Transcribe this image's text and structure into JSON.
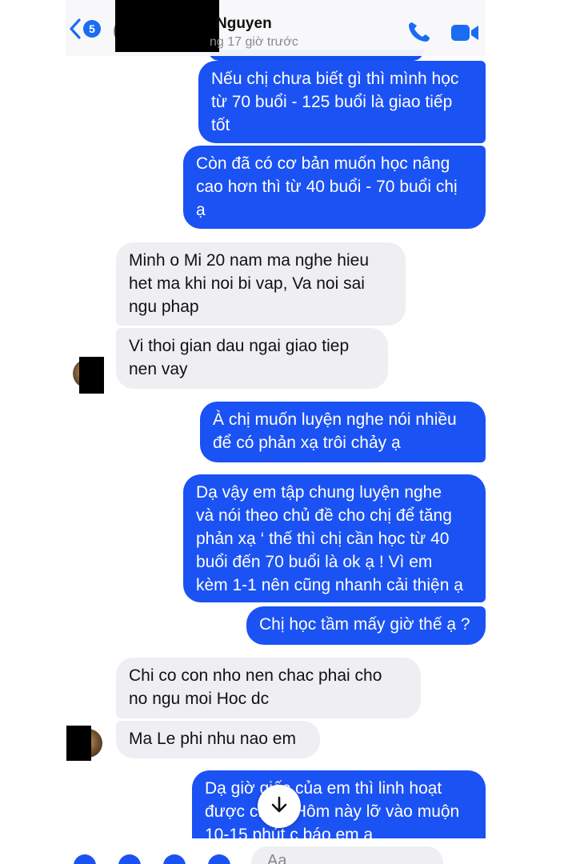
{
  "header": {
    "back_badge": "5",
    "contact_name": "Nguyen",
    "contact_status": "ng 17 giờ trước"
  },
  "messages": [
    {
      "sender": "me",
      "text": "Nếu chị chưa biết gì thì mình học\ntừ 70 buổi - 125 buổi là giao tiếp\ntốt"
    },
    {
      "sender": "me",
      "text": "Còn đã có cơ bản muốn học nâng\ncao hơn thì từ 40 buổi - 70 buổi chị\nạ"
    },
    {
      "sender": "other",
      "text": "Minh o Mi 20 nam ma nghe hieu\nhet ma khi noi bi vap, Va noi sai\nngu phap"
    },
    {
      "sender": "other",
      "text": "Vi thoi gian dau ngai giao tiep\nnen vay"
    },
    {
      "sender": "me",
      "text": "À chị muốn luyện nghe nói nhiều\nđể có phản xạ trôi chảy ạ"
    },
    {
      "sender": "me",
      "text": "Dạ vậy em tập chung luyện nghe\nvà nói theo chủ đề cho chị để tăng\nphản xạ ‘ thế thì chị cần học từ 40\nbuổi đến 70 buổi là ok ạ ! Vì em\nkèm 1-1 nên cũng nhanh cải thiện ạ"
    },
    {
      "sender": "me",
      "text": "Chị học tầm mấy giờ thế ạ ?"
    },
    {
      "sender": "other",
      "text": "Chi co con nho nen chac phai cho\nno ngu moi Hoc dc"
    },
    {
      "sender": "other",
      "text": "Ma Le phi nhu nao em"
    },
    {
      "sender": "me",
      "text": "Dạ giờ giấc của em thì linh hoạt\nđược chị ạ. Hôm này lỡ vào muộn\n10-15 phút c báo em ạ"
    }
  ],
  "composer": {
    "placeholder": "Aa"
  },
  "colors": {
    "outgoing_bubble": "#1b52f3",
    "incoming_bubble": "#efeff3",
    "accent": "#1a6cf2"
  },
  "icons": [
    "chevron-left-icon",
    "phone-icon",
    "video-camera-icon",
    "arrow-down-icon"
  ]
}
